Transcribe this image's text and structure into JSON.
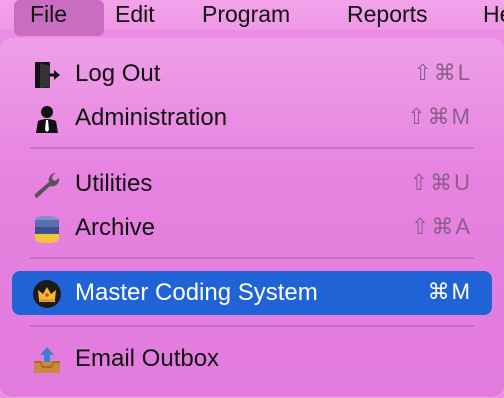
{
  "menubar": {
    "items": [
      "File",
      "Edit",
      "Program",
      "Reports",
      "He"
    ]
  },
  "menu": {
    "items": [
      {
        "label": "Log Out",
        "shortcut": "⇧⌘L",
        "icon": "log-out-icon"
      },
      {
        "label": "Administration",
        "shortcut": "⇧⌘M",
        "icon": "administrator-icon"
      },
      {
        "label": "Utilities",
        "shortcut": "⇧⌘U",
        "icon": "wrench-icon"
      },
      {
        "label": "Archive",
        "shortcut": "⇧⌘A",
        "icon": "database-icon"
      },
      {
        "label": "Master Coding System",
        "shortcut": "⌘M",
        "icon": "crown-icon"
      },
      {
        "label": "Email Outbox",
        "shortcut": "",
        "icon": "outbox-tray-icon"
      }
    ]
  },
  "colors": {
    "highlight": "#1f63d6",
    "menu_background": "#e782e0"
  }
}
